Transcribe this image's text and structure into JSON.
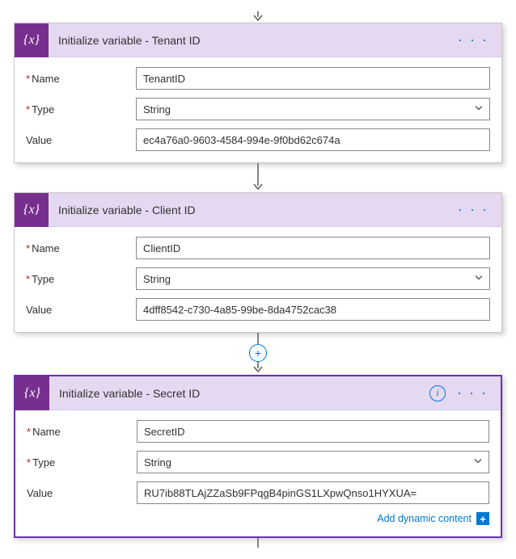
{
  "labels": {
    "name": "Name",
    "type": "Type",
    "value": "Value",
    "add_dynamic": "Add dynamic content"
  },
  "cards": [
    {
      "title": "Initialize variable - Tenant ID",
      "name_value": "TenantID",
      "type_value": "String",
      "value_value": "ec4a76a0-9603-4584-994e-9f0bd62c674a",
      "selected": false,
      "show_info": false,
      "show_dynamic": false
    },
    {
      "title": "Initialize variable - Client ID",
      "name_value": "ClientID",
      "type_value": "String",
      "value_value": "4dff8542-c730-4a85-99be-8da4752cac38",
      "selected": false,
      "show_info": false,
      "show_dynamic": false
    },
    {
      "title": "Initialize variable - Secret ID",
      "name_value": "SecretID",
      "type_value": "String",
      "value_value": "RU7ib88TLAjZZaSb9FPqgB4pinGS1LXpwQnso1HYXUA=",
      "selected": true,
      "show_info": true,
      "show_dynamic": true
    }
  ]
}
